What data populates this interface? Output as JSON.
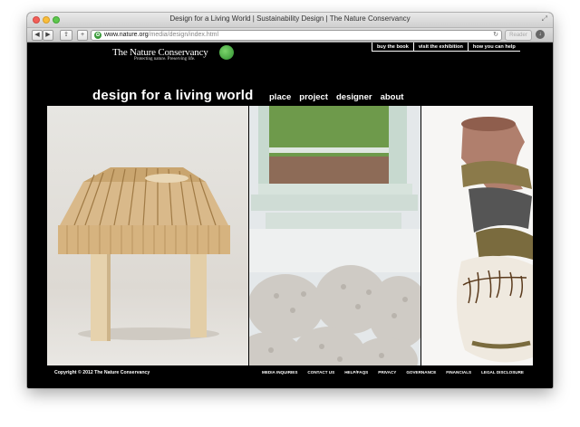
{
  "browser": {
    "title": "Design for a Living World | Sustainability Design | The Nature Conservancy",
    "url_host": "www.nature.org",
    "url_path": "/media/design/index.html",
    "reader_label": "Reader",
    "reload_icon": "reload-icon",
    "download_icon": "downloads-icon"
  },
  "header": {
    "logo_name": "The Nature Conservancy",
    "logo_tagline": "Protecting nature. Preserving life.",
    "site_title": "design for a living world",
    "top_links": [
      "buy the book",
      "visit the exhibition",
      "how you can help"
    ],
    "nav": [
      "place",
      "project",
      "designer",
      "about"
    ]
  },
  "hero": {
    "panels": [
      "wooden-slat-bench",
      "knitted-felt-rug-by-window",
      "wrapped-ceramic-vase"
    ]
  },
  "footer": {
    "copyright": "Copyright © 2012 The Nature Conservancy",
    "links": [
      "MEDIA INQUIRIES",
      "CONTACT US",
      "HELP/FAQS",
      "PRIVACY",
      "GOVERNANCE",
      "FINANCIALS",
      "LEGAL DISCLOSURE"
    ]
  }
}
